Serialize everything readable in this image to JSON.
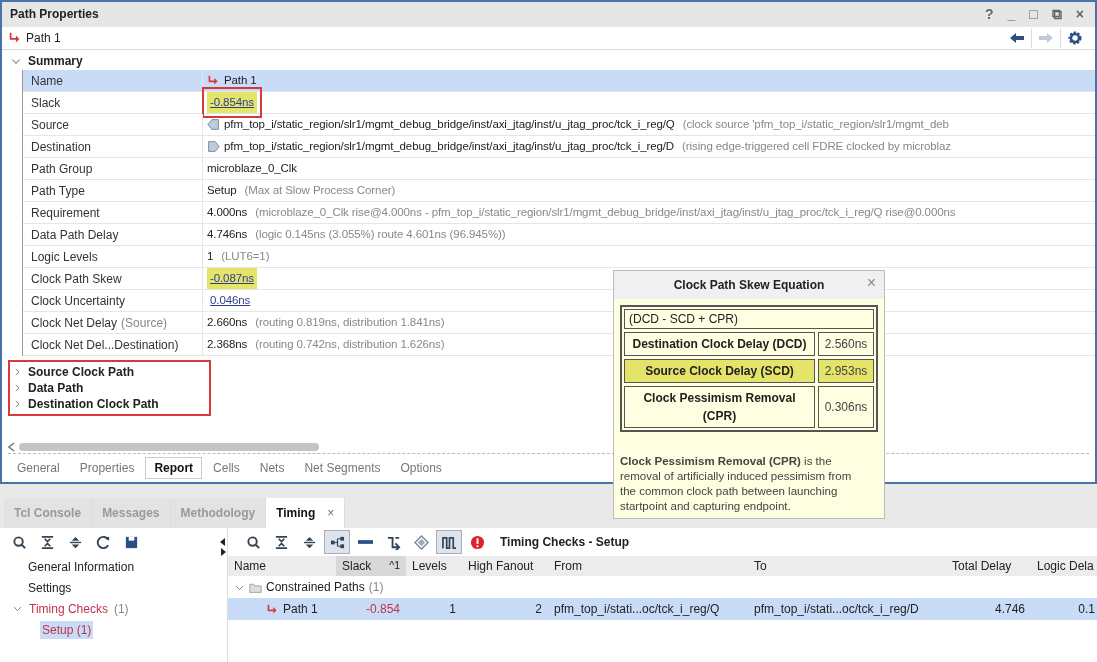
{
  "properties_window": {
    "title": "Path Properties",
    "controls": [
      "?",
      "_",
      "□",
      "⧉",
      "×"
    ],
    "object": {
      "label": "Path 1"
    },
    "nav": [
      {
        "kind": "back",
        "disabled": false
      },
      {
        "kind": "forward",
        "disabled": true
      },
      {
        "kind": "settings",
        "disabled": false
      }
    ],
    "summary": {
      "title": "Summary",
      "expanded": true,
      "rows": [
        {
          "label": "Name",
          "value": "Path 1",
          "kind": "path",
          "selected": true
        },
        {
          "label": "Slack",
          "value": "-0.854ns",
          "link": true,
          "highlight": true,
          "callout": true,
          "selected": false
        },
        {
          "label": "Source",
          "value": "pfm_top_i/static_region/slr1/mgmt_debug_bridge/inst/axi_jtag/inst/u_jtag_proc/tck_i_reg/Q",
          "detail": "(clock source 'pfm_top_i/static_region/slr1/mgmt_deb",
          "kind": "source",
          "selected": false
        },
        {
          "label": "Destination",
          "value": "pfm_top_i/static_region/slr1/mgmt_debug_bridge/inst/axi_jtag/inst/u_jtag_proc/tck_i_reg/D",
          "detail": "(rising edge-triggered cell FDRE clocked by microblaz",
          "kind": "destination",
          "selected": false
        },
        {
          "label": "Path Group",
          "value": "microblaze_0_Clk",
          "selected": false
        },
        {
          "label": "Path Type",
          "value": "Setup",
          "detail": "(Max at Slow Process Corner)",
          "selected": false
        },
        {
          "label": "Requirement",
          "value": "4.000ns",
          "detail": "(microblaze_0_Clk rise@4.000ns - pfm_top_i/static_region/slr1/mgmt_debug_bridge/inst/axi_jtag/inst/u_jtag_proc/tck_i_reg/Q rise@0.000ns",
          "selected": false
        },
        {
          "label": "Data Path Delay",
          "value": "4.746ns",
          "detail": "(logic 0.145ns (3.055%)  route 4.601ns (96.945%))",
          "selected": false
        },
        {
          "label": "Logic Levels",
          "value": "1",
          "detail": "(LUT6=1)",
          "selected": false
        },
        {
          "label": "Clock Path Skew",
          "value": "-0.087ns",
          "link": true,
          "highlight": true,
          "selected": false
        },
        {
          "label": "Clock Uncertainty",
          "value": "0.046ns",
          "link": true,
          "selected": false
        },
        {
          "label": "Clock Net Delay",
          "label_note": "(Source)",
          "value": "2.660ns",
          "detail": "(routing 0.819ns, distribution 1.841ns)",
          "selected": false
        },
        {
          "label": "Clock Net Del...Destination)",
          "value": "2.368ns",
          "detail": "(routing 0.742ns, distribution 1.626ns)",
          "selected": false
        }
      ]
    },
    "sections": {
      "callout": true,
      "items": [
        {
          "title": "Source Clock Path",
          "expanded": false
        },
        {
          "title": "Data Path",
          "expanded": false
        },
        {
          "title": "Destination Clock Path",
          "expanded": false
        }
      ]
    },
    "tabs": [
      {
        "label": "General",
        "selected": false
      },
      {
        "label": "Properties",
        "selected": false
      },
      {
        "label": "Report",
        "selected": true
      },
      {
        "label": "Cells",
        "selected": false
      },
      {
        "label": "Nets",
        "selected": false
      },
      {
        "label": "Net Segments",
        "selected": false
      },
      {
        "label": "Options",
        "selected": false
      }
    ]
  },
  "popup": {
    "title": "Clock Path Skew Equation",
    "close": "×",
    "formula": "(DCD - SCD + CPR)",
    "terms": [
      {
        "label": "Destination Clock Delay (DCD)",
        "value": "2.560ns",
        "highlight": false
      },
      {
        "label": "Source Clock Delay (SCD)",
        "value": "2.953ns",
        "highlight": true
      },
      {
        "label": "Clock Pessimism Removal (CPR)",
        "value": "0.306ns",
        "highlight": false
      }
    ],
    "note": "**Clock Pessimism Removal (CPR)** is the removal of artificially induced pessimism from the common clock path between launching startpoint and capturing endpoint."
  },
  "bottom_panel": {
    "tabs": [
      {
        "label": "Tcl Console",
        "selected": false
      },
      {
        "label": "Messages",
        "selected": false
      },
      {
        "label": "Methodology",
        "selected": false
      },
      {
        "label": "Timing",
        "selected": true,
        "close": "×"
      }
    ],
    "left_toolbar": [
      {
        "kind": "search",
        "pressed": false
      },
      {
        "kind": "collapse",
        "pressed": false
      },
      {
        "kind": "expand",
        "pressed": false
      },
      {
        "kind": "refresh",
        "pressed": false
      },
      {
        "kind": "save",
        "pressed": false
      }
    ],
    "tree": [
      {
        "label": "General Information",
        "selected": false
      },
      {
        "label": "Settings",
        "selected": false
      },
      {
        "label": "Timing Checks",
        "count": "(1)",
        "expanded": true,
        "selected": false,
        "children": [
          {
            "label": "Setup (1)",
            "selected": true
          }
        ]
      }
    ],
    "right_toolbar": [
      {
        "kind": "search",
        "pressed": false
      },
      {
        "kind": "collapse",
        "pressed": false
      },
      {
        "kind": "expand",
        "pressed": false
      },
      {
        "kind": "hierarchy",
        "pressed": true
      },
      {
        "kind": "minus",
        "pressed": false
      },
      {
        "kind": "route",
        "pressed": false
      },
      {
        "kind": "diamond",
        "pressed": false
      },
      {
        "kind": "waveform",
        "pressed": true
      },
      {
        "kind": "error",
        "pressed": false
      }
    ],
    "title": "Timing Checks - Setup",
    "table": {
      "columns": [
        {
          "label": "Name",
          "sorted": false
        },
        {
          "label": "Slack",
          "sorted": true,
          "sort_mark": "^1"
        },
        {
          "label": "Levels",
          "sorted": false
        },
        {
          "label": "High Fanout",
          "sorted": false
        },
        {
          "label": "From",
          "sorted": false
        },
        {
          "label": "To",
          "sorted": false
        },
        {
          "label": "Total Delay",
          "sorted": false
        },
        {
          "label": "Logic Dela",
          "sorted": false
        }
      ],
      "group": {
        "label": "Constrained Paths",
        "count": "(1)",
        "expanded": true
      },
      "rows": [
        {
          "cells": [
            "Path 1",
            "-0.854",
            "1",
            "2",
            "pfm_top_i/stati...oc/tck_i_reg/Q",
            "pfm_top_i/stati...oc/tck_i_reg/D",
            "4.746",
            "0.1"
          ],
          "selected": true
        }
      ]
    }
  }
}
